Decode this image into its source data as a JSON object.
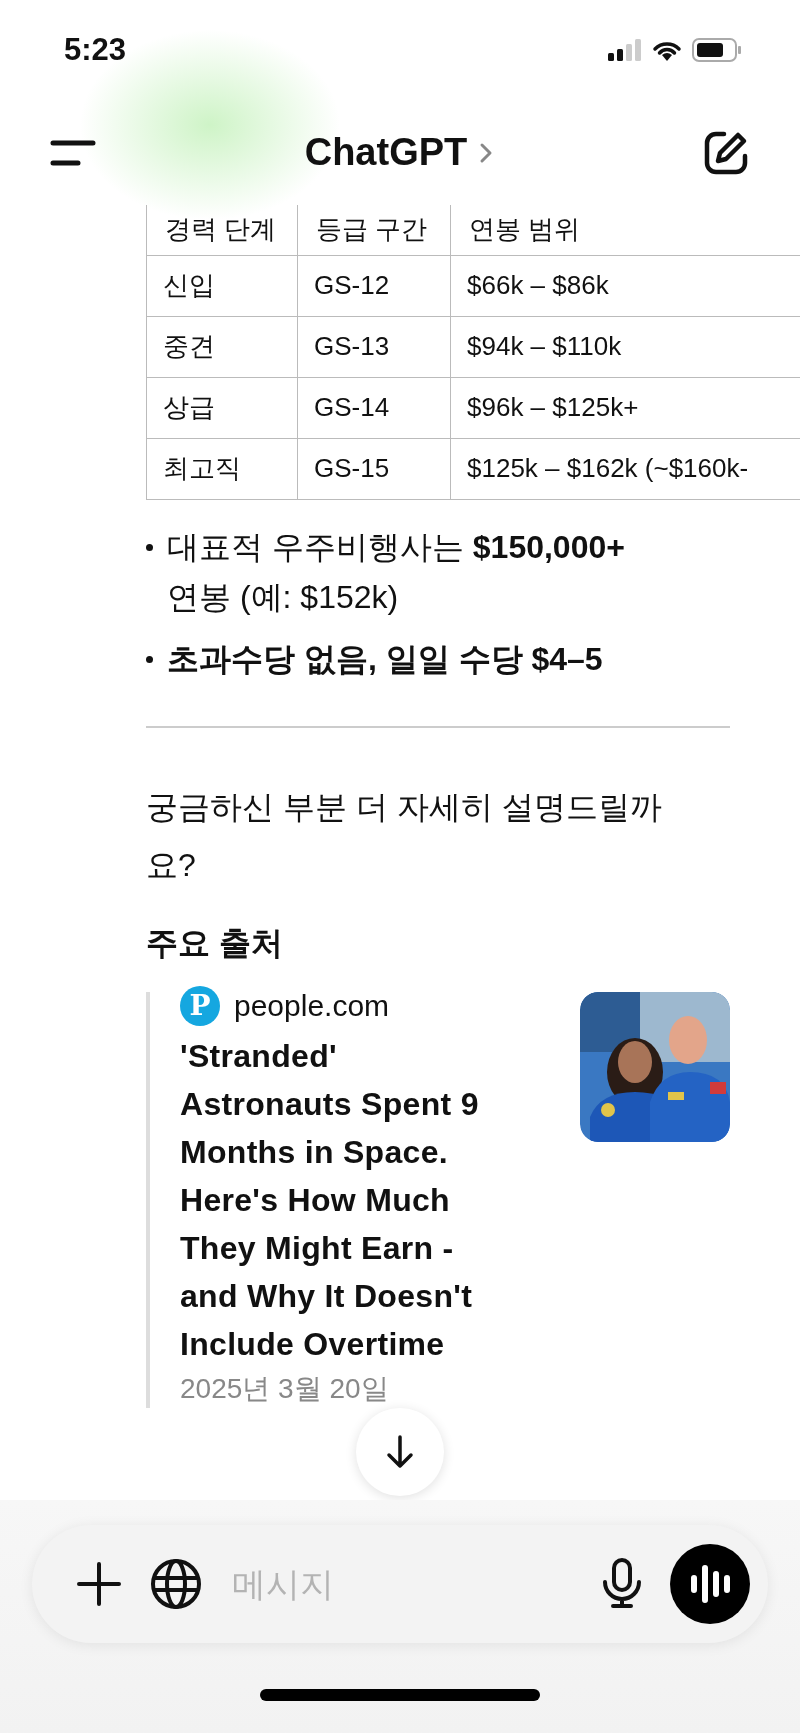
{
  "status_bar": {
    "time": "5:23"
  },
  "header": {
    "title": "ChatGPT"
  },
  "table": {
    "columns": [
      "경력 단계",
      "등급 구간",
      "연봉 범위"
    ],
    "rows": [
      [
        "신입",
        "GS-12",
        "$66k – $86k"
      ],
      [
        "중견",
        "GS-13",
        "$94k – $110k"
      ],
      [
        "상급",
        "GS-14",
        "$96k – $125k+"
      ],
      [
        "최고직",
        "GS-15",
        "$125k – $162k (~$160k-"
      ]
    ]
  },
  "bullets": [
    {
      "text": "대표적 우주비행사는 **$150,000+** 연봉 (예: $152k)",
      "bold": false
    },
    {
      "text": "초과수당 없음, 일일 수당 $4–5",
      "bold": true
    }
  ],
  "question": "궁금하신 부분 더 자세히 설명드릴까요?",
  "sources_heading": "주요 출처",
  "sources": [
    {
      "logo_text": "P",
      "site": "people.com",
      "title": "'Stranded' Astronauts Spent 9 Months in Space. Here's How Much They Might Earn - and Why It Doesn't Include Overtime",
      "date": "2025년 3월 20일"
    }
  ],
  "composer": {
    "placeholder": "메시지"
  }
}
